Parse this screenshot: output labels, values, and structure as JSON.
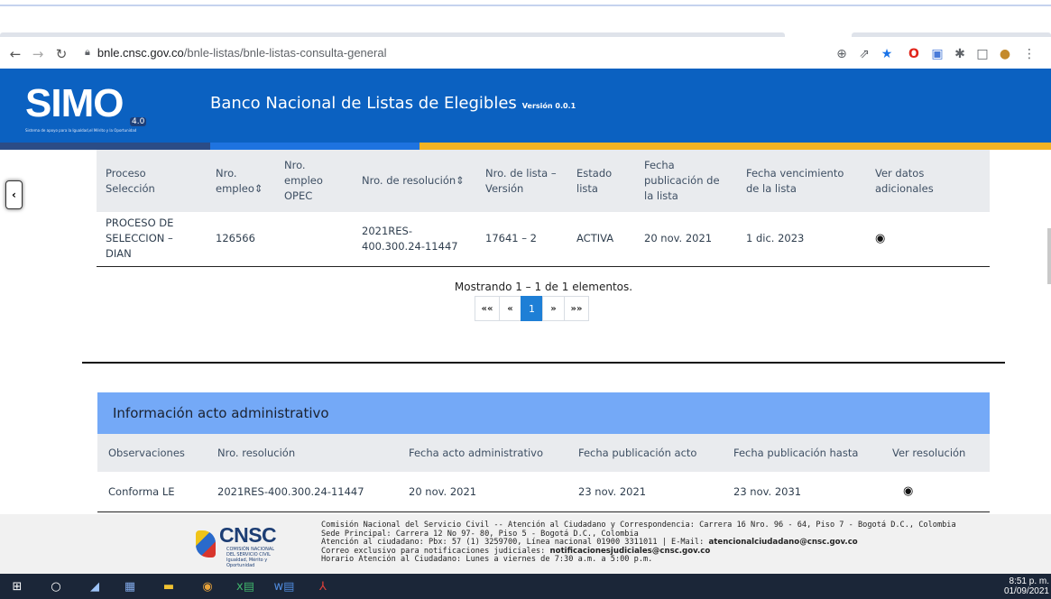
{
  "browser": {
    "url_host": "bnle.cnsc.gov.co",
    "url_path": "/bnle-listas/bnle-listas-consulta-general"
  },
  "header": {
    "logo_text": "SIMO",
    "logo_version_badge": "4.0",
    "logo_tagline": "Sistema de apoyo para la Igualdad,el Mérito y la Oportunidad",
    "title": "Banco Nacional de Listas de Elegibles",
    "version": "Versión 0.0.1"
  },
  "colors": {
    "header_blue": "#0b61c1",
    "accent_yellow": "#f3b323",
    "card_header_blue": "#74a9f7",
    "pager_active": "#1e7fd6"
  },
  "results": {
    "columns": [
      "Proceso Selección",
      "Nro. empleo⇕",
      "Nro. empleo OPEC",
      "Nro. de resolución⇕",
      "Nro. de lista – Versión",
      "Estado lista",
      "Fecha publicación de la lista",
      "Fecha vencimiento de la lista",
      "Ver datos adicionales"
    ],
    "rows": [
      {
        "proceso": "PROCESO DE SELECCION – DIAN",
        "nro_empleo": "126566",
        "nro_empleo_opec": "",
        "nro_resolucion": "2021RES-400.300.24-11447",
        "nro_lista": "17641 – 2",
        "estado": "ACTIVA",
        "fecha_publicacion": "20 nov. 2021",
        "fecha_vencimiento": "1 dic. 2023",
        "ver_icon": "eye-icon"
      }
    ],
    "summary": "Mostrando 1 – 1 de 1 elementos.",
    "pager": {
      "first": "««",
      "prev": "«",
      "current": "1",
      "next": "»",
      "last": "»»"
    }
  },
  "admin": {
    "heading": "Información acto administrativo",
    "columns": [
      "Observaciones",
      "Nro. resolución",
      "Fecha acto administrativo",
      "Fecha publicación acto",
      "Fecha publicación hasta",
      "Ver resolución"
    ],
    "rows": [
      {
        "observaciones": "Conforma LE",
        "nro_resolucion": "2021RES-400.300.24-11447",
        "fecha_acto": "20 nov. 2021",
        "fecha_publicacion": "23 nov. 2021",
        "fecha_hasta": "23 nov. 2031",
        "ver_icon": "eye-icon"
      }
    ]
  },
  "footer": {
    "logo_name": "CNSC",
    "logo_sub1": "COMISIÓN NACIONAL",
    "logo_sub2": "DEL SERVICIO CIVIL",
    "logo_sub3": "Igualdad, Mérito y Oportunidad",
    "line1": "Comisión Nacional del Servicio Civil -- Atención al Ciudadano y Correspondencia: Carrera 16 Nro. 96 - 64, Piso 7 - Bogotá D.C., Colombia",
    "line2": "Sede Principal: Carrera 12 No 97- 80, Piso 5 - Bogotá D.C., Colombia",
    "line3_prefix": "Atención al ciudadano: Pbx: 57 (1) 3259700, Línea nacional 01900 3311011 | E-Mail:",
    "line3_email": "atencionalciudadano@cnsc.gov.co",
    "line4_prefix": "Correo exclusivo para notificaciones judiciales:",
    "line4_email": "notificacionesjudiciales@cnsc.gov.co",
    "line5": "Horario Atención al Ciudadano: Lunes a viernes de 7:30 a.m. a 5:00 p.m."
  },
  "taskbar": {
    "time": "8:51 p. m.",
    "date": "01/09/2021"
  }
}
